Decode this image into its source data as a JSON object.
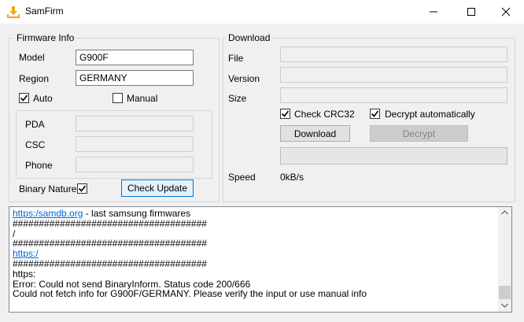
{
  "window": {
    "title": "SamFirm"
  },
  "firmware_info": {
    "title": "Firmware Info",
    "model_label": "Model",
    "model_value": "G900F",
    "region_label": "Region",
    "region_value": "GERMANY",
    "auto_label": "Auto",
    "auto_checked": true,
    "manual_label": "Manual",
    "manual_checked": false,
    "pda_label": "PDA",
    "csc_label": "CSC",
    "phone_label": "Phone",
    "binary_nature_label": "Binary Nature",
    "binary_nature_checked": true,
    "check_update_label": "Check Update"
  },
  "download": {
    "title": "Download",
    "file_label": "File",
    "version_label": "Version",
    "size_label": "Size",
    "check_crc32_label": "Check CRC32",
    "check_crc32_checked": true,
    "decrypt_auto_label": "Decrypt automatically",
    "decrypt_auto_checked": true,
    "download_label": "Download",
    "decrypt_label": "Decrypt",
    "speed_label": "Speed",
    "speed_value": "0kB/s"
  },
  "log": {
    "line1_link": "https:/samdb.org",
    "line1_rest": " - last samsung firmwares",
    "line2": " #####################################",
    "line3": "/",
    "line4": " #####################################",
    "line5_link": "https:/",
    "line6": " #####################################",
    "line7": "https:",
    "line8": "Error: Could not send BinaryInform. Status code 200/666",
    "line9": "Could not fetch info for G900F/GERMANY. Please verify the input or use manual info"
  },
  "icons": {
    "app": "download-arrow-icon",
    "minimize": "minimize-icon",
    "maximize": "maximize-icon",
    "close": "close-icon",
    "check": "checkmark-icon"
  },
  "colors": {
    "link": "#0066cc",
    "accent": "#0078d7",
    "app_icon": "#f2a516"
  }
}
